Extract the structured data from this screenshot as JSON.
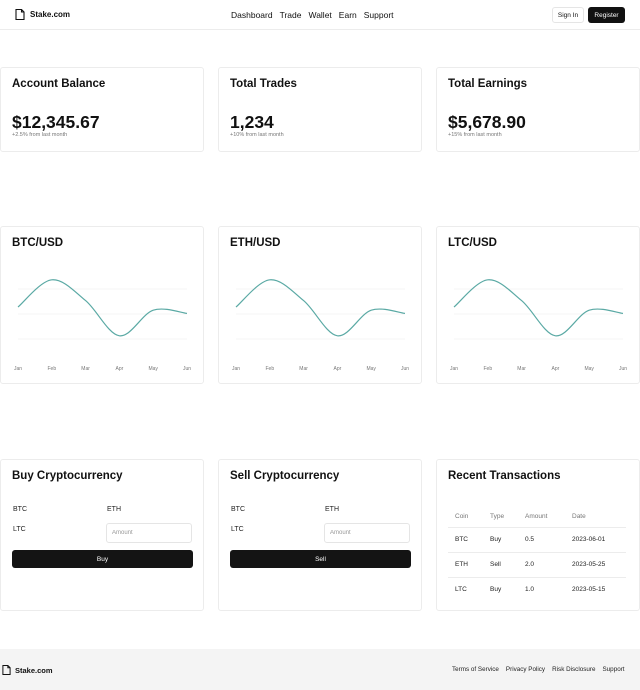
{
  "header": {
    "brand": "Stake.com",
    "nav": [
      "Dashboard",
      "Trade",
      "Wallet",
      "Earn",
      "Support"
    ],
    "sign_in": "Sign In",
    "register": "Register"
  },
  "stats": [
    {
      "title": "Account Balance",
      "value": "$12,345.67",
      "change": "+2.5% from last month"
    },
    {
      "title": "Total Trades",
      "value": "1,234",
      "change": "+10% from last month"
    },
    {
      "title": "Total Earnings",
      "value": "$5,678.90",
      "change": "+15% from last month"
    }
  ],
  "charts": [
    {
      "title": "BTC/USD"
    },
    {
      "title": "ETH/USD"
    },
    {
      "title": "LTC/USD"
    }
  ],
  "chart_data": [
    {
      "type": "line",
      "title": "BTC/USD",
      "categories": [
        "Jan",
        "Feb",
        "Mar",
        "Apr",
        "May",
        "Jun"
      ],
      "values": [
        2.0,
        3.7,
        2.4,
        0.2,
        1.8,
        1.6
      ],
      "color": "#5aa9a4"
    },
    {
      "type": "line",
      "title": "ETH/USD",
      "categories": [
        "Jan",
        "Feb",
        "Mar",
        "Apr",
        "May",
        "Jun"
      ],
      "values": [
        2.0,
        3.7,
        2.4,
        0.2,
        1.8,
        1.6
      ],
      "color": "#5aa9a4"
    },
    {
      "type": "line",
      "title": "LTC/USD",
      "categories": [
        "Jan",
        "Feb",
        "Mar",
        "Apr",
        "May",
        "Jun"
      ],
      "values": [
        2.0,
        3.7,
        2.4,
        0.2,
        1.8,
        1.6
      ],
      "color": "#5aa9a4"
    }
  ],
  "buy": {
    "title": "Buy Cryptocurrency",
    "coins": [
      "BTC",
      "ETH",
      "LTC"
    ],
    "amount_placeholder": "Amount",
    "button": "Buy"
  },
  "sell": {
    "title": "Sell Cryptocurrency",
    "coins": [
      "BTC",
      "ETH",
      "LTC"
    ],
    "amount_placeholder": "Amount",
    "button": "Sell"
  },
  "transactions": {
    "title": "Recent Transactions",
    "columns": [
      "Coin",
      "Type",
      "Amount",
      "Date"
    ],
    "rows": [
      [
        "BTC",
        "Buy",
        "0.5",
        "2023-06-01"
      ],
      [
        "ETH",
        "Sell",
        "2.0",
        "2023-05-25"
      ],
      [
        "LTC",
        "Buy",
        "1.0",
        "2023-05-15"
      ]
    ]
  },
  "footer": {
    "brand": "Stake.com",
    "links": [
      "Terms of Service",
      "Privacy Policy",
      "Risk Disclosure",
      "Support"
    ]
  }
}
